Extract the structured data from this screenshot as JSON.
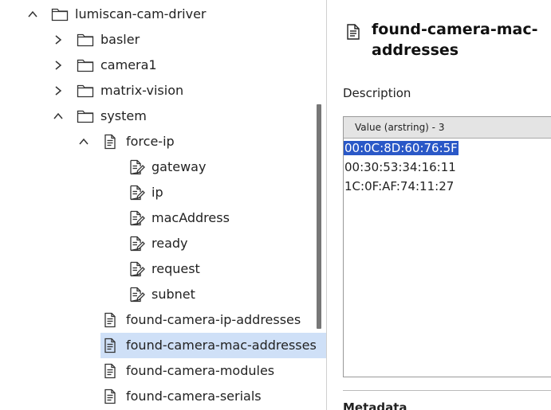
{
  "tree": {
    "items": [
      {
        "label": "lumiscan-cam-driver",
        "chevron": "up",
        "icon": "folder"
      },
      {
        "label": "basler",
        "chevron": "right",
        "icon": "folder"
      },
      {
        "label": "camera1",
        "chevron": "right",
        "icon": "folder"
      },
      {
        "label": "matrix-vision",
        "chevron": "right",
        "icon": "folder"
      },
      {
        "label": "system",
        "chevron": "up",
        "icon": "folder"
      },
      {
        "label": "force-ip",
        "chevron": "up",
        "icon": "document"
      },
      {
        "label": "gateway",
        "icon": "edit-document"
      },
      {
        "label": "ip",
        "icon": "edit-document"
      },
      {
        "label": "macAddress",
        "icon": "edit-document"
      },
      {
        "label": "ready",
        "icon": "edit-document"
      },
      {
        "label": "request",
        "icon": "edit-document"
      },
      {
        "label": "subnet",
        "icon": "edit-document"
      },
      {
        "label": "found-camera-ip-addresses",
        "icon": "document"
      },
      {
        "label": "found-camera-mac-addresses",
        "icon": "document",
        "selected": true
      },
      {
        "label": "found-camera-modules",
        "icon": "document"
      },
      {
        "label": "found-camera-serials",
        "icon": "document"
      }
    ]
  },
  "detail": {
    "title": "found-camera-mac-addresses",
    "description_label": "Description",
    "table_header": "Value (arstring) - 3",
    "values": [
      "00:0C:8D:60:76:5F",
      "00:30:53:34:16:11",
      "1C:0F:AF:74:11:27"
    ],
    "selected_index": 0,
    "next_section_peek": "Metadata"
  },
  "colors": {
    "selection_row": "#cfe0f7",
    "selection_text_bg": "#2a58c7"
  }
}
